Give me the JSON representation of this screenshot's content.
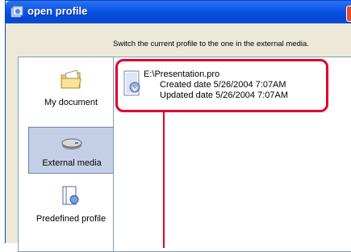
{
  "window": {
    "title": "open profile"
  },
  "instruction": "Switch the current profile to the one in the external media.",
  "sidebar": {
    "items": [
      {
        "label": "My document",
        "icon": "folder-icon",
        "selected": false
      },
      {
        "label": "External media",
        "icon": "drive-icon",
        "selected": true
      },
      {
        "label": "Predefined profile",
        "icon": "profile-icon",
        "selected": false
      }
    ]
  },
  "file": {
    "path": "E:\\Presentation.pro",
    "created": "Created date 5/26/2004 7:07AM",
    "updated": "Updated date 5/26/2004 7:07AM"
  },
  "colors": {
    "title_bar": "#0a54e4",
    "highlight": "#e0002a",
    "selected_bg": "#c4cfe7"
  }
}
